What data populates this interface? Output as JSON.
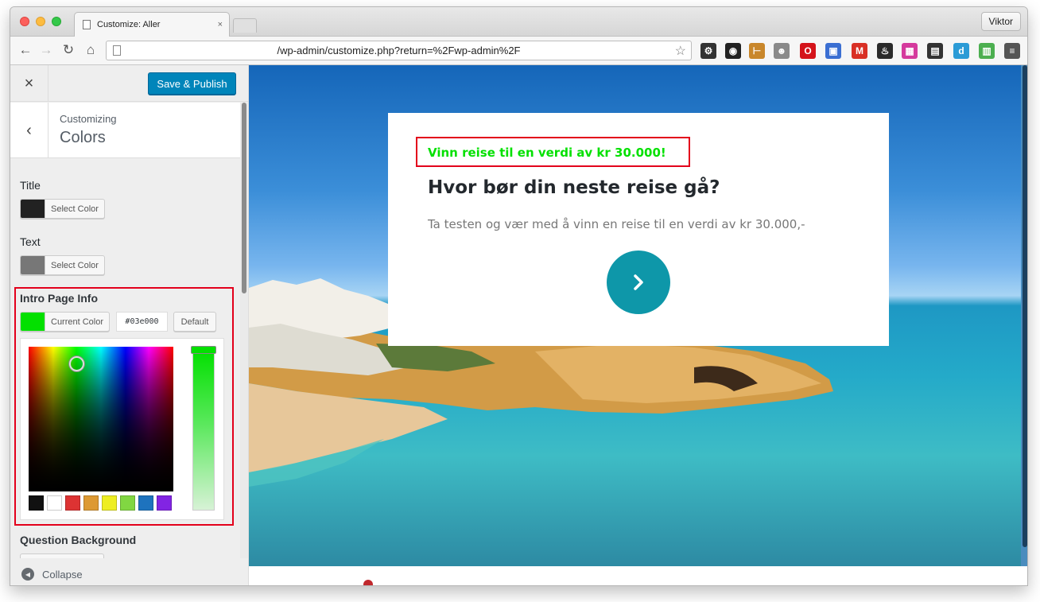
{
  "browser": {
    "tab_title": "Customize: Aller",
    "tab_close": "×",
    "profile": "Viktor",
    "url": "/wp-admin/customize.php?return=%2Fwp-admin%2F",
    "extensions": [
      {
        "name": "gear-extension-icon",
        "color": "#333333",
        "glyph": "⚙"
      },
      {
        "name": "color-wheel-extension-icon",
        "color": "#222222",
        "glyph": "◉"
      },
      {
        "name": "ruler-extension-icon",
        "color": "#c9872b",
        "glyph": "⊢"
      },
      {
        "name": "robot-extension-icon",
        "color": "#8a8a8a",
        "glyph": "☻"
      },
      {
        "name": "opera-extension-icon",
        "color": "#d4131a",
        "glyph": "O"
      },
      {
        "name": "window-extension-icon",
        "color": "#3b6fd2",
        "glyph": "▣"
      },
      {
        "name": "gmail-extension-icon",
        "color": "#d93025",
        "glyph": "M"
      },
      {
        "name": "flame-extension-icon",
        "color": "#2b2b2b",
        "glyph": "♨"
      },
      {
        "name": "gradient-extension-icon",
        "color": "#d53a9d",
        "glyph": "▦"
      },
      {
        "name": "film-extension-icon",
        "color": "#333333",
        "glyph": "▤"
      },
      {
        "name": "d-extension-icon",
        "color": "#2b9bd6",
        "glyph": "d"
      },
      {
        "name": "page-extension-icon",
        "color": "#4caf50",
        "glyph": "▥"
      },
      {
        "name": "menu-icon",
        "color": "#555555",
        "glyph": "≡"
      }
    ]
  },
  "customizer": {
    "close": "×",
    "publish_label": "Save & Publish",
    "back": "‹",
    "breadcrumb": "Customizing",
    "section_title": "Colors",
    "controls": {
      "title": {
        "label": "Title",
        "button": "Select Color",
        "color": "#222222"
      },
      "text": {
        "label": "Text",
        "button": "Select Color",
        "color": "#777777"
      },
      "intro": {
        "label": "Intro Page Info",
        "button": "Current Color",
        "color": "#03e000",
        "hex": "#03e000",
        "default_label": "Default"
      },
      "question_bg": {
        "label": "Question Background"
      }
    },
    "palette": [
      "#111111",
      "#ffffff",
      "#dd3333",
      "#dd9933",
      "#eeee22",
      "#81d742",
      "#1e73be",
      "#8224e3"
    ],
    "collapse_label": "Collapse"
  },
  "preview": {
    "intro_info": "Vinn reise til en verdi av kr 30.000!",
    "title": "Hvor bør din neste reise gå?",
    "text": "Ta testen og vær med å vinn en reise til en verdi av kr 30.000,-",
    "next_icon": "›",
    "accent": "#0e97a9",
    "highlight": "#e3001b"
  }
}
